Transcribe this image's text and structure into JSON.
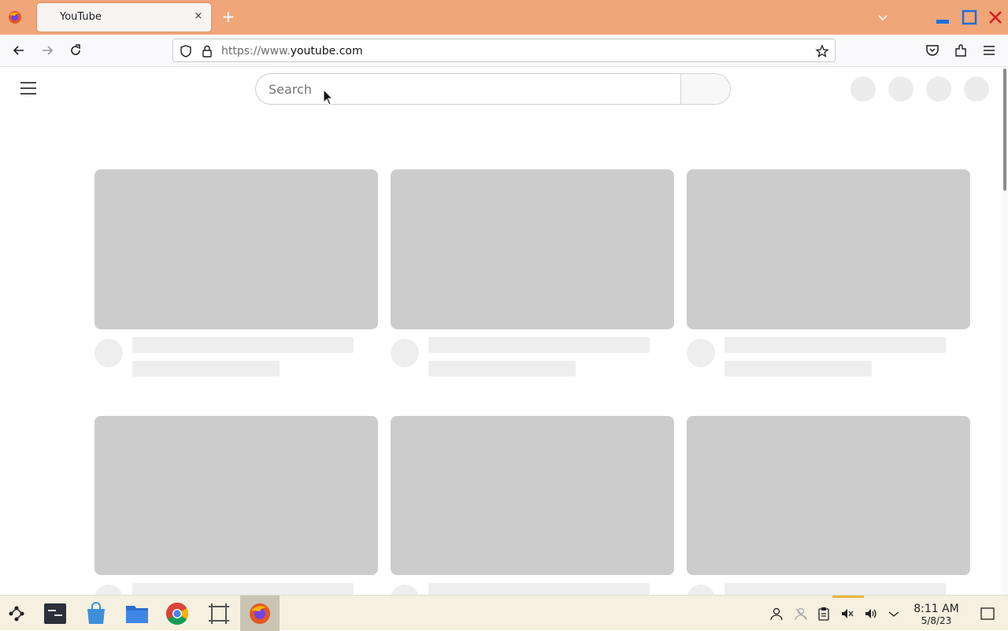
{
  "browser": {
    "tab_title": "YouTube",
    "tab_close": "×",
    "new_tab": "+",
    "url_prefix": "https://www.",
    "url_domain": "youtube.com",
    "accent_color": "#f0a679"
  },
  "page": {
    "search_placeholder": "Search"
  },
  "taskbar": {
    "time": "8:11 AM",
    "date": "5/8/23",
    "apps": [
      "app-launcher-icon",
      "terminal-icon",
      "store-icon",
      "file-manager-icon",
      "chrome-icon",
      "screenshot-tool-icon",
      "firefox-icon"
    ],
    "tray": [
      "user-icon",
      "network-icon",
      "clipboard-icon",
      "mute-icon",
      "volume-icon",
      "chevron-up-icon"
    ]
  }
}
